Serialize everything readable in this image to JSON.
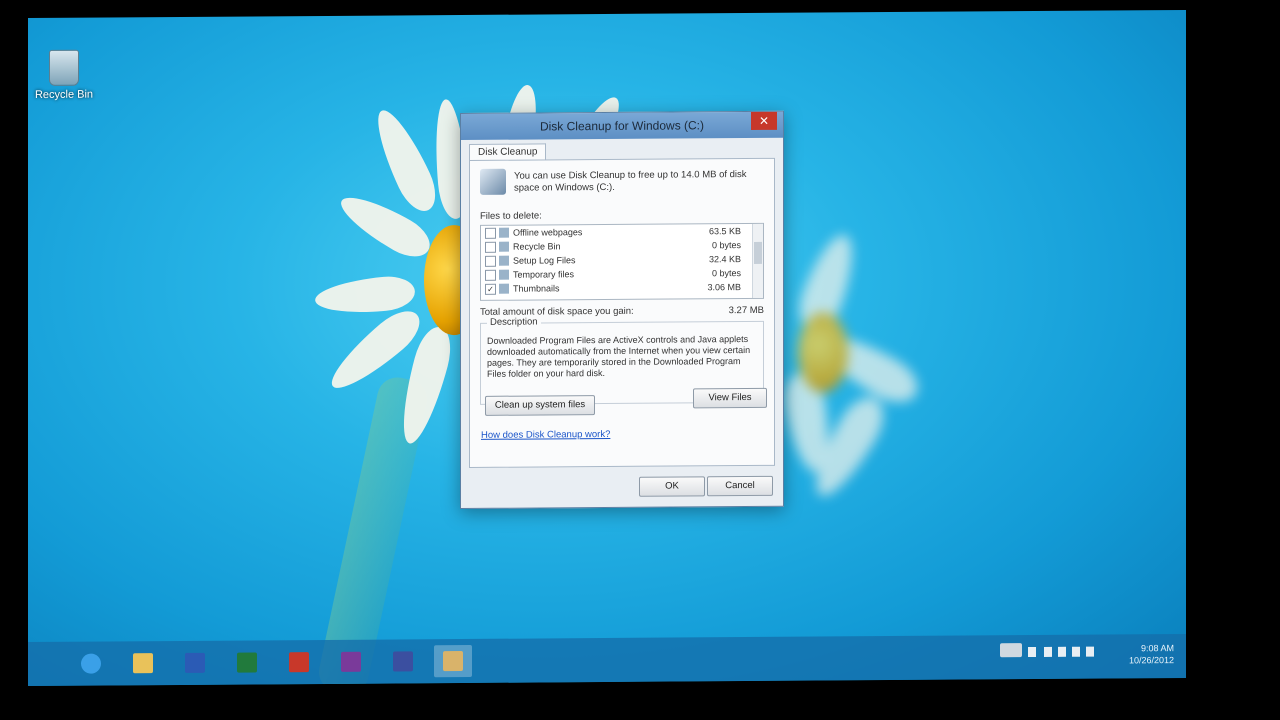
{
  "desktop": {
    "recycle_bin_label": "Recycle Bin"
  },
  "dialog": {
    "title": "Disk Cleanup for Windows (C:)",
    "close_glyph": "✕",
    "tab_label": "Disk Cleanup",
    "intro_text": "You can use Disk Cleanup to free up to 14.0 MB of disk space on Windows (C:).",
    "files_to_delete_label": "Files to delete:",
    "files": [
      {
        "name": "Offline webpages",
        "size": "63.5 KB",
        "checked": false
      },
      {
        "name": "Recycle Bin",
        "size": "0 bytes",
        "checked": false
      },
      {
        "name": "Setup Log Files",
        "size": "32.4 KB",
        "checked": false
      },
      {
        "name": "Temporary files",
        "size": "0 bytes",
        "checked": false
      },
      {
        "name": "Thumbnails",
        "size": "3.06 MB",
        "checked": true
      }
    ],
    "total_label": "Total amount of disk space you gain:",
    "total_value": "3.27 MB",
    "description_label": "Description",
    "description_text": "Downloaded Program Files are ActiveX controls and Java applets downloaded automatically from the Internet when you view certain pages. They are temporarily stored in the Downloaded Program Files folder on your hard disk.",
    "cleanup_system_button": "Clean up system files",
    "view_files_button": "View Files",
    "help_link": "How does Disk Cleanup work?",
    "ok_button": "OK",
    "cancel_button": "Cancel"
  },
  "taskbar": {
    "apps": [
      {
        "name": "internet-explorer-icon",
        "color": "#3aa0e8"
      },
      {
        "name": "file-explorer-icon",
        "color": "#e9c25a"
      },
      {
        "name": "word-icon",
        "color": "#2b5bb5"
      },
      {
        "name": "excel-icon",
        "color": "#217a3c"
      },
      {
        "name": "powerpoint-icon",
        "color": "#c8382a"
      },
      {
        "name": "onenote-icon",
        "color": "#7a3a9a"
      },
      {
        "name": "visio-icon",
        "color": "#3b4fa0"
      },
      {
        "name": "disk-cleanup-icon",
        "color": "#d9b36a"
      }
    ],
    "time": "9:08 AM",
    "date": "10/26/2012"
  }
}
